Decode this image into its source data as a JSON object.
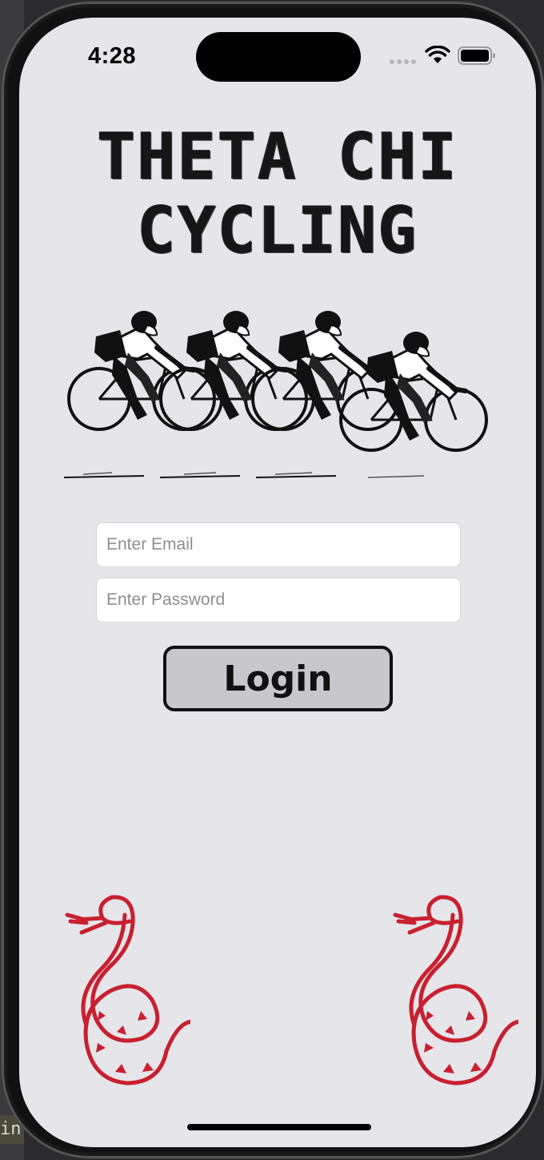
{
  "status_bar": {
    "time": "4:28"
  },
  "app": {
    "title_line1": "THETA CHI",
    "title_line2": "CYCLING"
  },
  "login_form": {
    "email_placeholder": "Enter Email",
    "password_placeholder": "Enter Password",
    "login_label": "Login"
  },
  "background": {
    "editor_fragment": "in"
  },
  "colors": {
    "screen_bg": "#e5e5ea",
    "snake": "#c8202f",
    "button_bg": "#c7c7cc"
  },
  "icons": [
    "cellular-dots-icon",
    "wifi-icon",
    "battery-icon",
    "cyclists-illustration",
    "snake-emblem-icon"
  ]
}
